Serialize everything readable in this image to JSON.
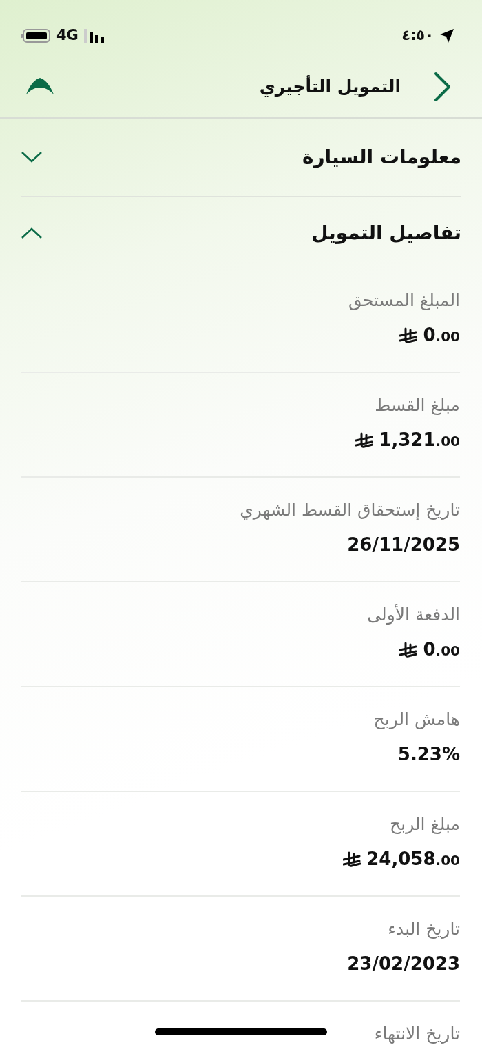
{
  "status_bar": {
    "time": "٤:٥٠",
    "network": "4G"
  },
  "header": {
    "title": "التمويل التأجيري"
  },
  "sections": [
    {
      "title": "معلومات السيارة",
      "expanded": false
    },
    {
      "title": "تفاصيل التمويل",
      "expanded": true,
      "fields": [
        {
          "label": "المبلغ المستحق",
          "value": "0.00",
          "kind": "money"
        },
        {
          "label": "مبلغ القسط",
          "value": "1,321.00",
          "kind": "money"
        },
        {
          "label": "تاريخ إستحقاق القسط الشهري",
          "value": "26/11/2025",
          "kind": "text"
        },
        {
          "label": "الدفعة الأولى",
          "value": "0.00",
          "kind": "money"
        },
        {
          "label": "هامش الربح",
          "value": "5.23%",
          "kind": "text"
        },
        {
          "label": "مبلغ الربح",
          "value": "24,058.00",
          "kind": "money"
        },
        {
          "label": "تاريخ البدء",
          "value": "23/02/2023",
          "kind": "text"
        },
        {
          "label": "تاريخ الانتهاء"
        }
      ]
    }
  ]
}
